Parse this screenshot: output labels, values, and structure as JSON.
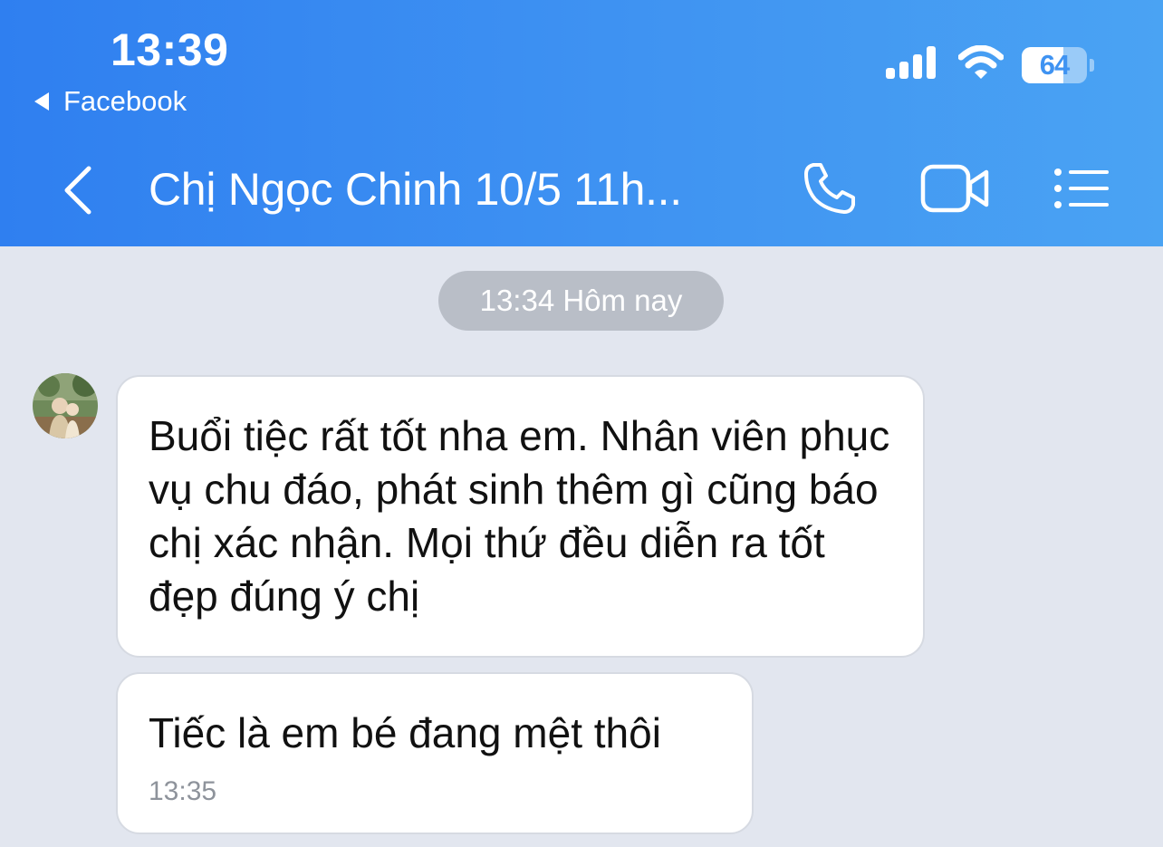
{
  "status_bar": {
    "time": "13:39",
    "back_app_label": "Facebook",
    "battery_percent": "64",
    "battery_level": 0.64,
    "icons": [
      "cellular-signal-icon",
      "wifi-icon",
      "battery-icon"
    ]
  },
  "chat_header": {
    "title": "Chị Ngọc Chinh 10/5 11h...",
    "icons": [
      "back-chevron-icon",
      "phone-icon",
      "video-camera-icon",
      "list-menu-icon"
    ]
  },
  "conversation": {
    "date_separator": "13:34 Hôm nay",
    "messages": [
      {
        "text": "Buổi tiệc rất tốt nha em. Nhân viên phục vụ chu đáo, phát sinh thêm gì cũng báo chị xác nhận. Mọi thứ đều diễn ra tốt đẹp đúng ý chị",
        "time": ""
      },
      {
        "text": "Tiếc là em bé đang mệt thôi",
        "time": "13:35"
      }
    ]
  },
  "colors": {
    "header_start": "#2f7ff0",
    "header_end": "#4aa3f3",
    "background": "#e2e6ef",
    "bubble": "#ffffff",
    "pill": "#b9bec7"
  }
}
